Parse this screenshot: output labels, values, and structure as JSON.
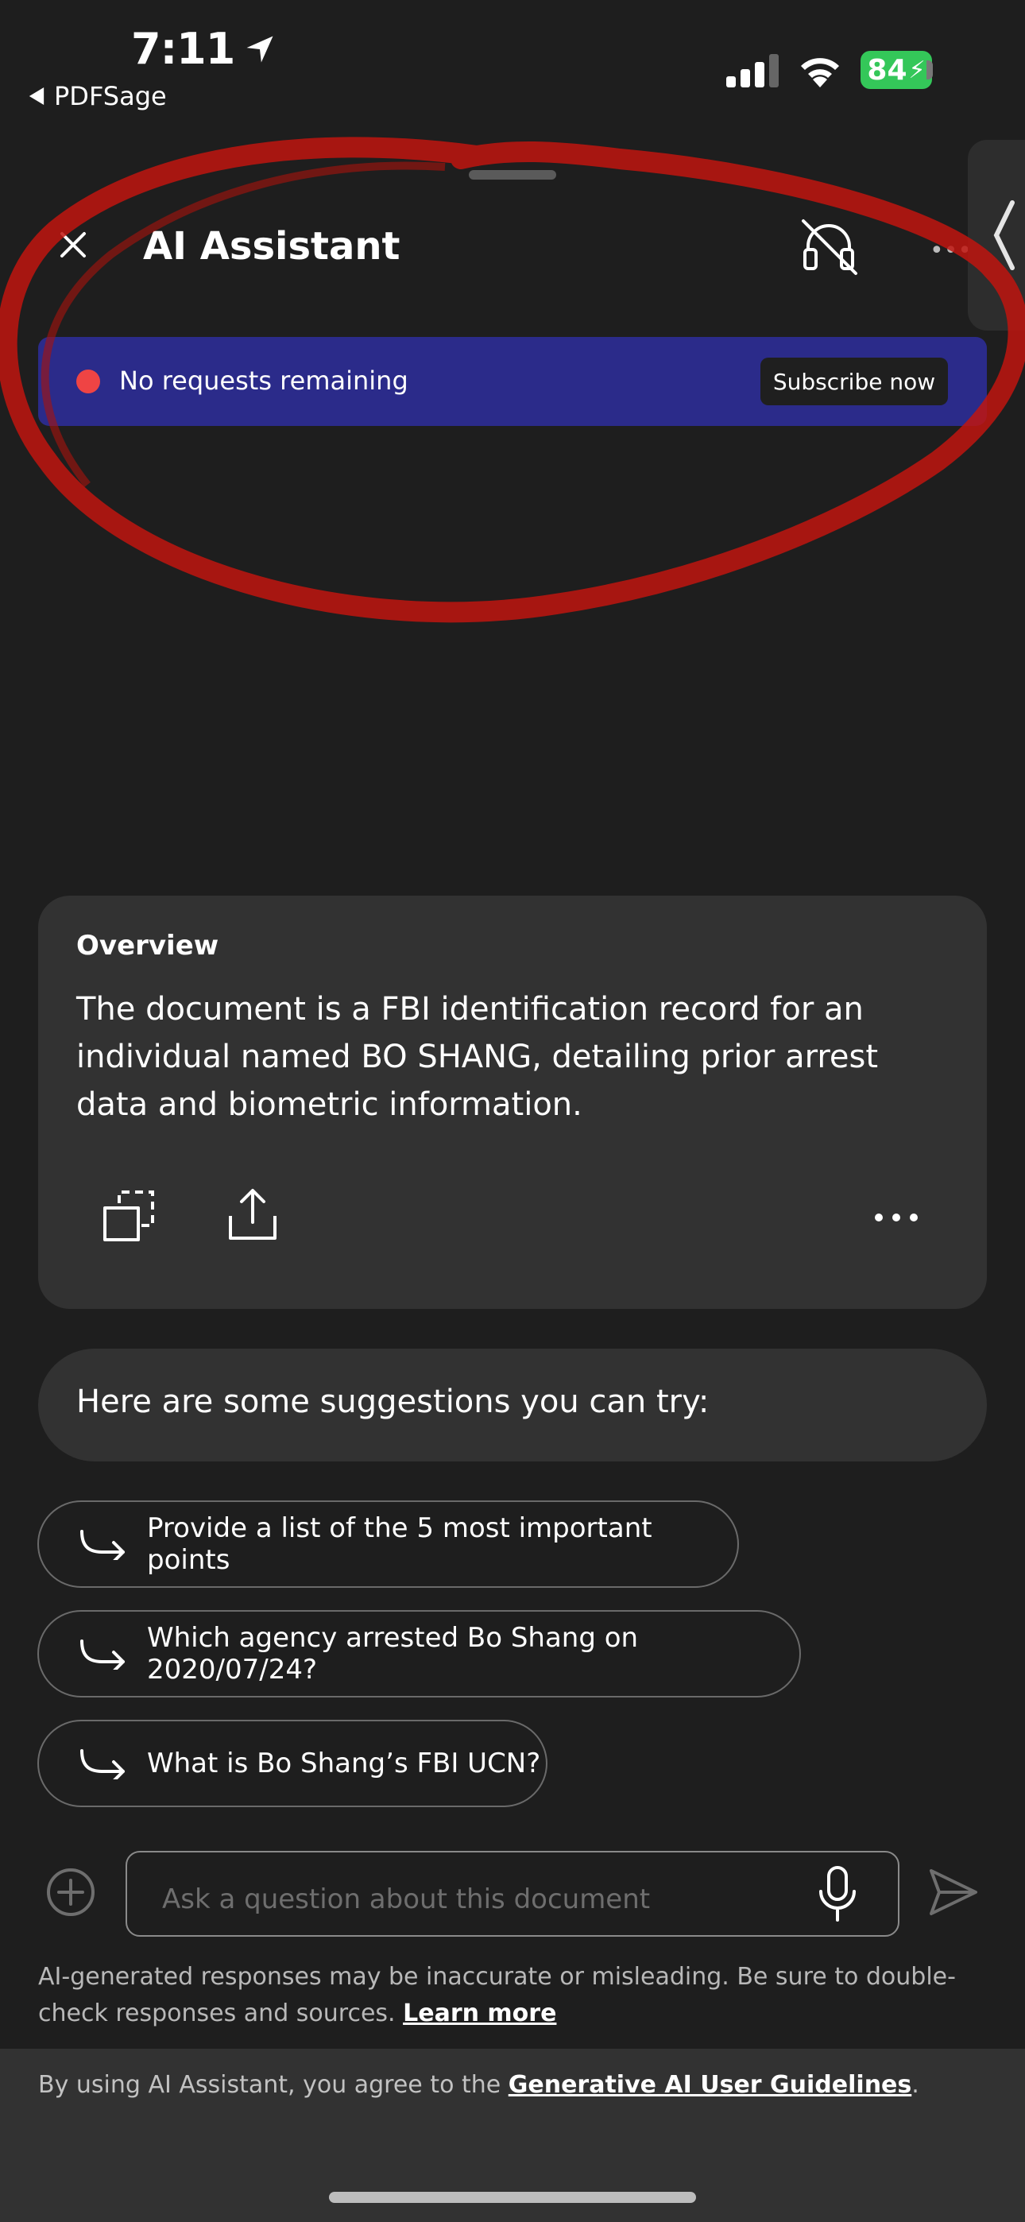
{
  "status_bar": {
    "time": "7:11",
    "back_app": "PDFSage",
    "battery": "84"
  },
  "header": {
    "title": "AI Assistant"
  },
  "banner": {
    "text": "No requests remaining",
    "subscribe_label": "Subscribe now"
  },
  "overview": {
    "label": "Overview",
    "text": "The document is a FBI identification record for an individual named BO SHANG, detailing prior arrest data and biometric information."
  },
  "suggestions": {
    "heading": "Here are some suggestions you can try:",
    "items": [
      "Provide a list of the 5 most important points",
      "Which agency arrested Bo Shang on 2020/07/24?",
      "What is Bo Shang’s FBI UCN?"
    ]
  },
  "input": {
    "placeholder": "Ask a question about this document"
  },
  "disclaimer": {
    "text": "AI-generated responses may be inaccurate or misleading. Be sure to double-check responses and sources. ",
    "link": "Learn more"
  },
  "footer": {
    "text": "By using AI Assistant, you agree to the ",
    "link": "Generative AI User Guidelines",
    "suffix": "."
  },
  "colors": {
    "background": "#1e1e1e",
    "banner": "#2b2b8a",
    "card": "#323232",
    "alert_dot": "#ef4444",
    "battery": "#34c759",
    "annotation": "#c0150f"
  },
  "icons": [
    "location-arrow-icon",
    "signal-icon",
    "wifi-icon",
    "close-icon",
    "headset-off-icon",
    "chevron-left-icon",
    "copy-icon",
    "share-icon",
    "more-icon",
    "turn-arrow-icon",
    "add-icon",
    "microphone-icon",
    "send-icon"
  ]
}
